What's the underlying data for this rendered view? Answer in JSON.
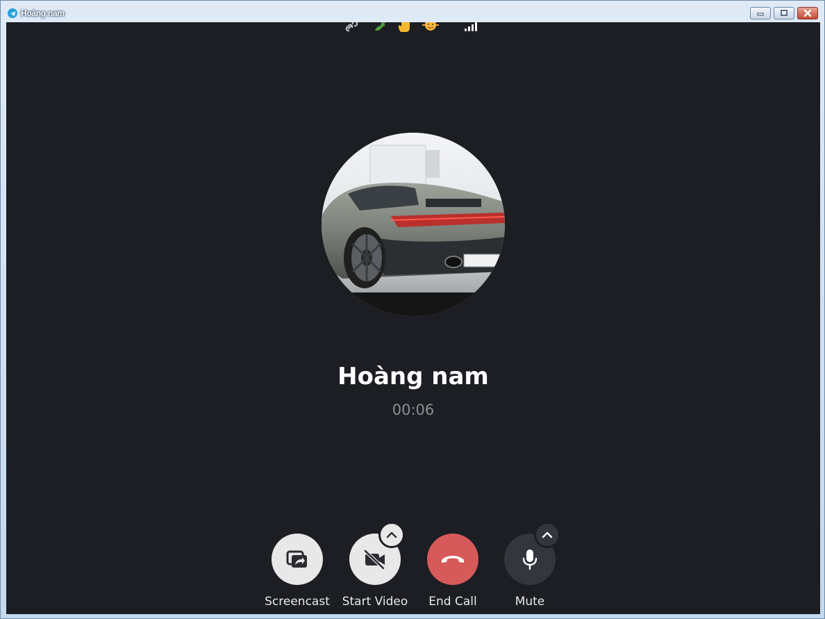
{
  "window": {
    "title": "Hoàng nam"
  },
  "call": {
    "peer_name": "Hoàng nam",
    "duration": "00:06",
    "signal_bars": 4
  },
  "status_emojis": [
    "link-icon",
    "dragon-icon",
    "hand-icon",
    "sun-icon"
  ],
  "controls": {
    "screencast": {
      "label": "Screencast",
      "icon": "screencast-icon"
    },
    "start_video": {
      "label": "Start Video",
      "icon": "video-off-icon"
    },
    "end_call": {
      "label": "End Call",
      "icon": "phone-hangup-icon"
    },
    "mute": {
      "label": "Mute",
      "icon": "microphone-icon"
    }
  },
  "colors": {
    "background": "#1c1e23",
    "end_call": "#d75a5a",
    "control_light": "#e8e8e8",
    "control_dark": "#33363c",
    "timer_text": "#8b8e93"
  }
}
